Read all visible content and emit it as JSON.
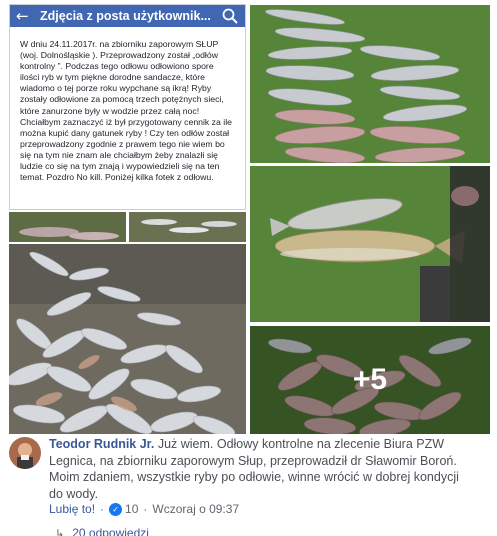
{
  "phone": {
    "title": "Zdjęcia z posta użytkownik...",
    "back_icon": "arrow-left-icon",
    "search_icon": "search-icon",
    "bar_color": "#4267b2",
    "post_text": "W dniu 24.11.2017r. na zbiorniku zaporowym SŁUP (woj. Dolnośląskie ). Przeprowadzony został „odłów kontrolny ”. Podczas tego odłowu odłowiono spore ilości ryb w tym piękne dorodne sandacze, które wiadomo o tej porze roku wypchane są ikrą! Ryby zostały odłowione za pomocą trzech potężnych sieci, które zanurzone były w wodzie  przez całą noc! Chciałbym zaznaczyć iż był przygotowany cennik za ile można kupić dany gatunek ryby ! Czy ten odłów został przeprowadzony zgodnie z prawem tego nie wiem bo się na tym nie znam ale chciałbym żeby znalazłi się ludzie co się na tym znają i wypowiedzieli się na ten temat.  Pozdro No kill. Poniżej kilka fotek z odłowu."
  },
  "gallery": {
    "more_count": "+5"
  },
  "comment": {
    "author": "Teodor Rudnik Jr.",
    "text": " Już wiem. Odłowy kontrolne na zlecenie Biura PZW Legnica, na zbiorniku zaporowym Słup, przeprowadził dr Sławomir Boroń. Moim zdaniem, wszystkie ryby po odłowie, winne wrócić w dobrej kondycji do wody.",
    "like_label": "Lubię to!",
    "dot": "·",
    "reaction_count": "10",
    "time": "Wczoraj o 09:37",
    "replies_label": "20 odpowiedzi",
    "link_color": "#385898",
    "like_color": "#1877f2"
  }
}
